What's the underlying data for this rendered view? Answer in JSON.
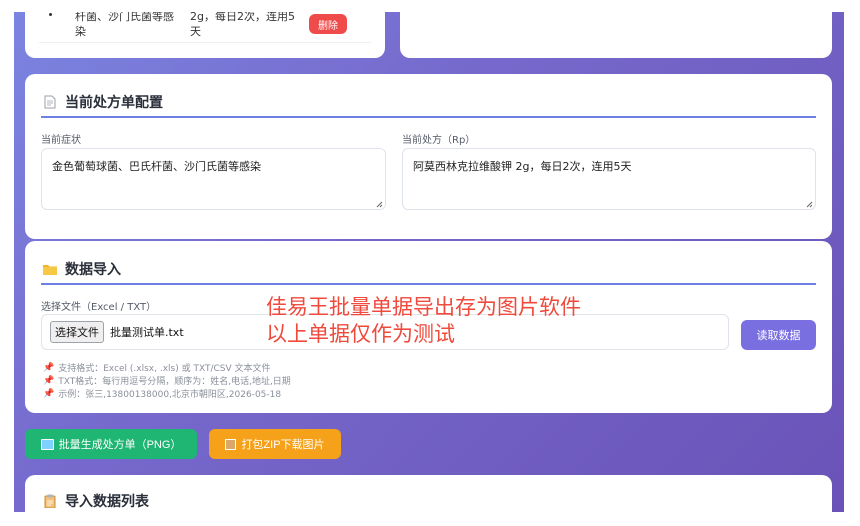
{
  "top_partial": {
    "row_text_1": "杆菌、沙门氏菌等感",
    "row_text_1b": "染",
    "row_text_2": "2g，每日2次，连用5",
    "row_text_2b": "天",
    "delete_label": "删除"
  },
  "prescription": {
    "title": "当前处方单配置",
    "symptom_label": "当前症状",
    "symptom_value": "金色葡萄球菌、巴氏杆菌、沙门氏菌等感染",
    "rp_label": "当前处方（Rp）",
    "rp_value": "阿莫西林克拉维酸钾 2g，每日2次，连用5天"
  },
  "import": {
    "title": "数据导入",
    "file_label": "选择文件（Excel / TXT）",
    "choose_button": "选择文件",
    "file_name": "批量测试单.txt",
    "read_button": "读取数据",
    "notes": [
      "支持格式：Excel (.xlsx, .xls) 或 TXT/CSV 文本文件",
      "TXT格式：每行用逗号分隔，顺序为：姓名,电话,地址,日期",
      "示例：张三,13800138000,北京市朝阳区,2026-05-18"
    ]
  },
  "watermark": {
    "line1": "佳易王批量单据导出存为图片软件",
    "line2": "以上单据仅作为测试"
  },
  "actions": {
    "generate_label": "批量生成处方单（PNG）",
    "zip_label": "打包ZIP下载图片"
  },
  "list": {
    "title": "导入数据列表"
  },
  "colors": {
    "accent": "#6f7fe6",
    "delete": "#ef4b4b",
    "generate": "#1fb572",
    "zip": "#f5a11a",
    "read": "#7a6fe0"
  }
}
